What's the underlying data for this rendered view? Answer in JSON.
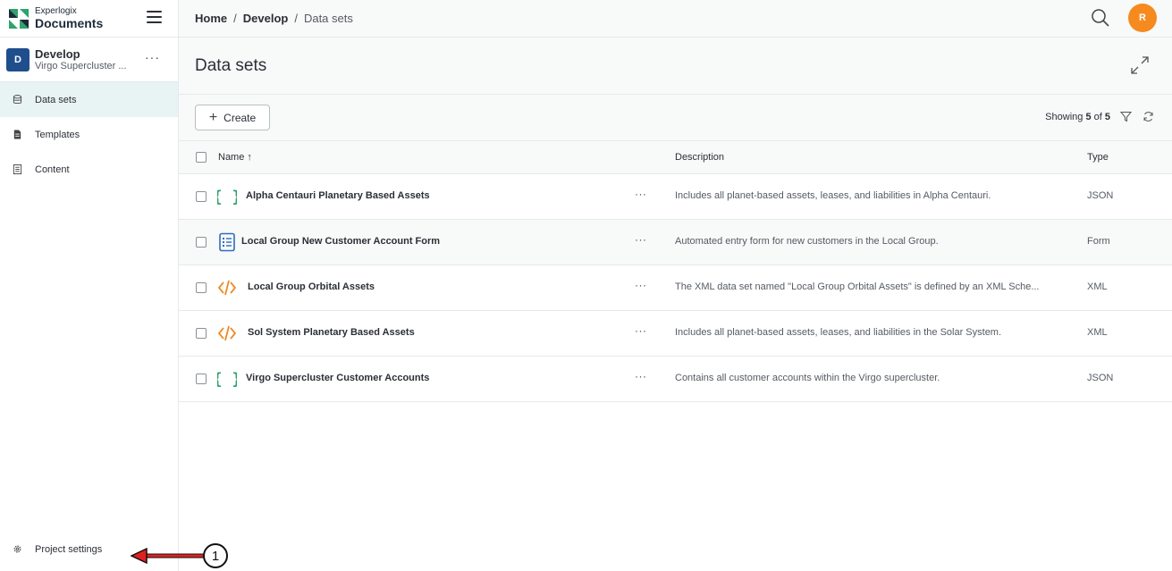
{
  "brand": {
    "line1": "Experlogix",
    "line2": "Documents"
  },
  "project": {
    "avatar": "D",
    "name": "Develop",
    "subtitle": "Virgo Supercluster ...",
    "more": "···"
  },
  "nav": {
    "items": [
      {
        "label": "Data sets",
        "icon": "database-icon",
        "active": true
      },
      {
        "label": "Templates",
        "icon": "file-icon",
        "active": false
      },
      {
        "label": "Content",
        "icon": "content-icon",
        "active": false
      }
    ],
    "settings_label": "Project settings"
  },
  "breadcrumb": {
    "home": "Home",
    "sep": "/",
    "develop": "Develop",
    "current": "Data sets"
  },
  "user": {
    "initial": "R"
  },
  "page": {
    "title": "Data sets"
  },
  "toolbar": {
    "create_label": "Create",
    "showing_prefix": "Showing",
    "shown": "5",
    "of": "of",
    "total": "5"
  },
  "table": {
    "headers": {
      "name": "Name",
      "sort_arrow": "↑",
      "description": "Description",
      "type": "Type"
    },
    "rows": [
      {
        "name": "Alpha Centauri Planetary Based Assets",
        "description": "Includes all planet-based assets, leases, and liabilities in Alpha Centauri.",
        "type": "JSON",
        "icon": "json-icon"
      },
      {
        "name": "Local Group New Customer Account Form",
        "description": "Automated entry form for new customers in the Local Group.",
        "type": "Form",
        "icon": "form-icon"
      },
      {
        "name": "Local Group Orbital Assets",
        "description": "The XML data set named \"Local Group Orbital Assets\" is defined by an XML Sche...",
        "type": "XML",
        "icon": "xml-icon"
      },
      {
        "name": "Sol System Planetary Based Assets",
        "description": "Includes all planet-based assets, leases, and liabilities in the Solar System.",
        "type": "XML",
        "icon": "xml-icon"
      },
      {
        "name": "Virgo Supercluster Customer Accounts",
        "description": "Contains all customer accounts within the Virgo supercluster.",
        "type": "JSON",
        "icon": "json-icon"
      }
    ],
    "more": "···"
  },
  "annotation": {
    "number": "1"
  },
  "colors": {
    "accent_orange": "#f68a1f",
    "json_green": "#2ea36a",
    "xml_orange": "#f08a24",
    "form_blue": "#2d6cc0",
    "project_blue": "#1f4e8c",
    "arrow_red": "#e02020"
  }
}
